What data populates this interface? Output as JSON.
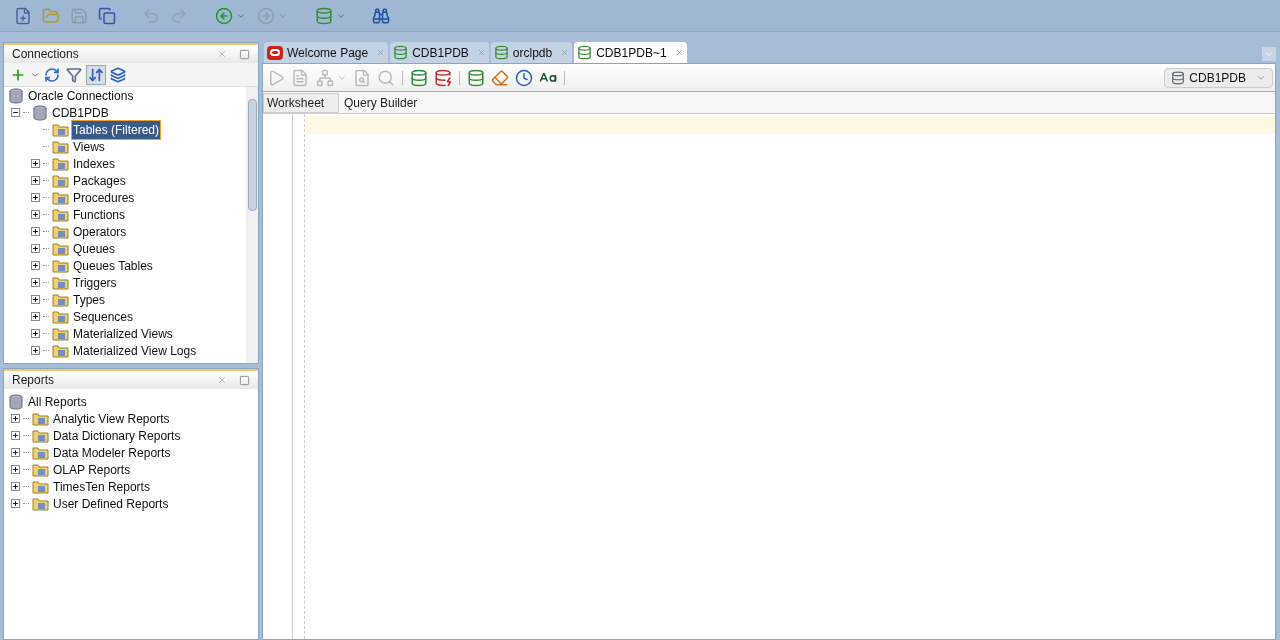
{
  "toolbar": {
    "items": [
      {
        "kind": "new",
        "disabled": false,
        "dropdown": false
      },
      {
        "kind": "open",
        "disabled": false,
        "dropdown": false
      },
      {
        "kind": "save",
        "disabled": true,
        "dropdown": false
      },
      {
        "kind": "save-all",
        "disabled": false,
        "dropdown": false
      },
      {
        "kind": "undo",
        "disabled": true,
        "dropdown": false
      },
      {
        "kind": "redo",
        "disabled": true,
        "dropdown": false
      },
      {
        "kind": "back",
        "disabled": false,
        "dropdown": true
      },
      {
        "kind": "forward",
        "disabled": true,
        "dropdown": true
      },
      {
        "kind": "sql",
        "disabled": false,
        "dropdown": true
      },
      {
        "kind": "find",
        "disabled": false,
        "dropdown": false
      }
    ]
  },
  "connections": {
    "title": "Connections",
    "tools": [
      {
        "kind": "add",
        "pressed": false
      },
      {
        "kind": "refresh",
        "pressed": false
      },
      {
        "kind": "filter",
        "pressed": false
      },
      {
        "kind": "schema",
        "pressed": true
      },
      {
        "kind": "collapse",
        "pressed": false
      }
    ],
    "tree": [
      {
        "label": "Oracle Connections",
        "kind": "root",
        "children": [
          {
            "label": "CDB1PDB",
            "kind": "connection",
            "expanded": true,
            "children": [
              {
                "label": "Tables (Filtered)",
                "kind": "folder",
                "expandable": false,
                "selected": true
              },
              {
                "label": "Views",
                "kind": "folder",
                "expandable": false,
                "selected": false
              },
              {
                "label": "Indexes",
                "kind": "folder",
                "expandable": true,
                "selected": false
              },
              {
                "label": "Packages",
                "kind": "folder",
                "expandable": true,
                "selected": false
              },
              {
                "label": "Procedures",
                "kind": "folder",
                "expandable": true,
                "selected": false
              },
              {
                "label": "Functions",
                "kind": "folder",
                "expandable": true,
                "selected": false
              },
              {
                "label": "Operators",
                "kind": "folder",
                "expandable": true,
                "selected": false
              },
              {
                "label": "Queues",
                "kind": "folder",
                "expandable": true,
                "selected": false
              },
              {
                "label": "Queues Tables",
                "kind": "folder",
                "expandable": true,
                "selected": false
              },
              {
                "label": "Triggers",
                "kind": "folder",
                "expandable": true,
                "selected": false
              },
              {
                "label": "Types",
                "kind": "folder",
                "expandable": true,
                "selected": false
              },
              {
                "label": "Sequences",
                "kind": "folder",
                "expandable": true,
                "selected": false
              },
              {
                "label": "Materialized Views",
                "kind": "folder",
                "expandable": true,
                "selected": false
              },
              {
                "label": "Materialized View Logs",
                "kind": "folder",
                "expandable": true,
                "selected": false
              }
            ]
          }
        ]
      }
    ]
  },
  "reports": {
    "title": "Reports",
    "tree": [
      {
        "label": "All Reports",
        "kind": "root",
        "children": [
          {
            "label": "Analytic View Reports",
            "kind": "folder",
            "expandable": true
          },
          {
            "label": "Data Dictionary Reports",
            "kind": "folder",
            "expandable": true
          },
          {
            "label": "Data Modeler Reports",
            "kind": "folder",
            "expandable": true
          },
          {
            "label": "OLAP Reports",
            "kind": "folder",
            "expandable": true
          },
          {
            "label": "TimesTen Reports",
            "kind": "folder",
            "expandable": true
          },
          {
            "label": "User Defined Reports",
            "kind": "folder",
            "expandable": true
          }
        ]
      }
    ]
  },
  "editor": {
    "tabs": [
      {
        "label": "Welcome Page",
        "kind": "welcome",
        "selected": false
      },
      {
        "label": "CDB1PDB",
        "kind": "sql",
        "selected": false
      },
      {
        "label": "orclpdb",
        "kind": "sql",
        "selected": false
      },
      {
        "label": "CDB1PDB~1",
        "kind": "sql",
        "selected": true
      }
    ],
    "tools": [
      {
        "kind": "run",
        "disabled": true
      },
      {
        "kind": "script",
        "disabled": true
      },
      {
        "kind": "explain",
        "disabled": true,
        "dropdown": true
      },
      {
        "kind": "autotrace",
        "disabled": true
      },
      {
        "kind": "tune",
        "disabled": true
      },
      {
        "kind": "commit",
        "disabled": false
      },
      {
        "kind": "rollback",
        "disabled": false
      },
      {
        "kind": "unshared",
        "disabled": false
      },
      {
        "kind": "clear",
        "disabled": false
      },
      {
        "kind": "history",
        "disabled": false
      },
      {
        "kind": "case",
        "disabled": false
      }
    ],
    "connection": "CDB1PDB",
    "subtabs": [
      {
        "label": "Worksheet",
        "selected": true
      },
      {
        "label": "Query Builder",
        "selected": false
      }
    ]
  }
}
